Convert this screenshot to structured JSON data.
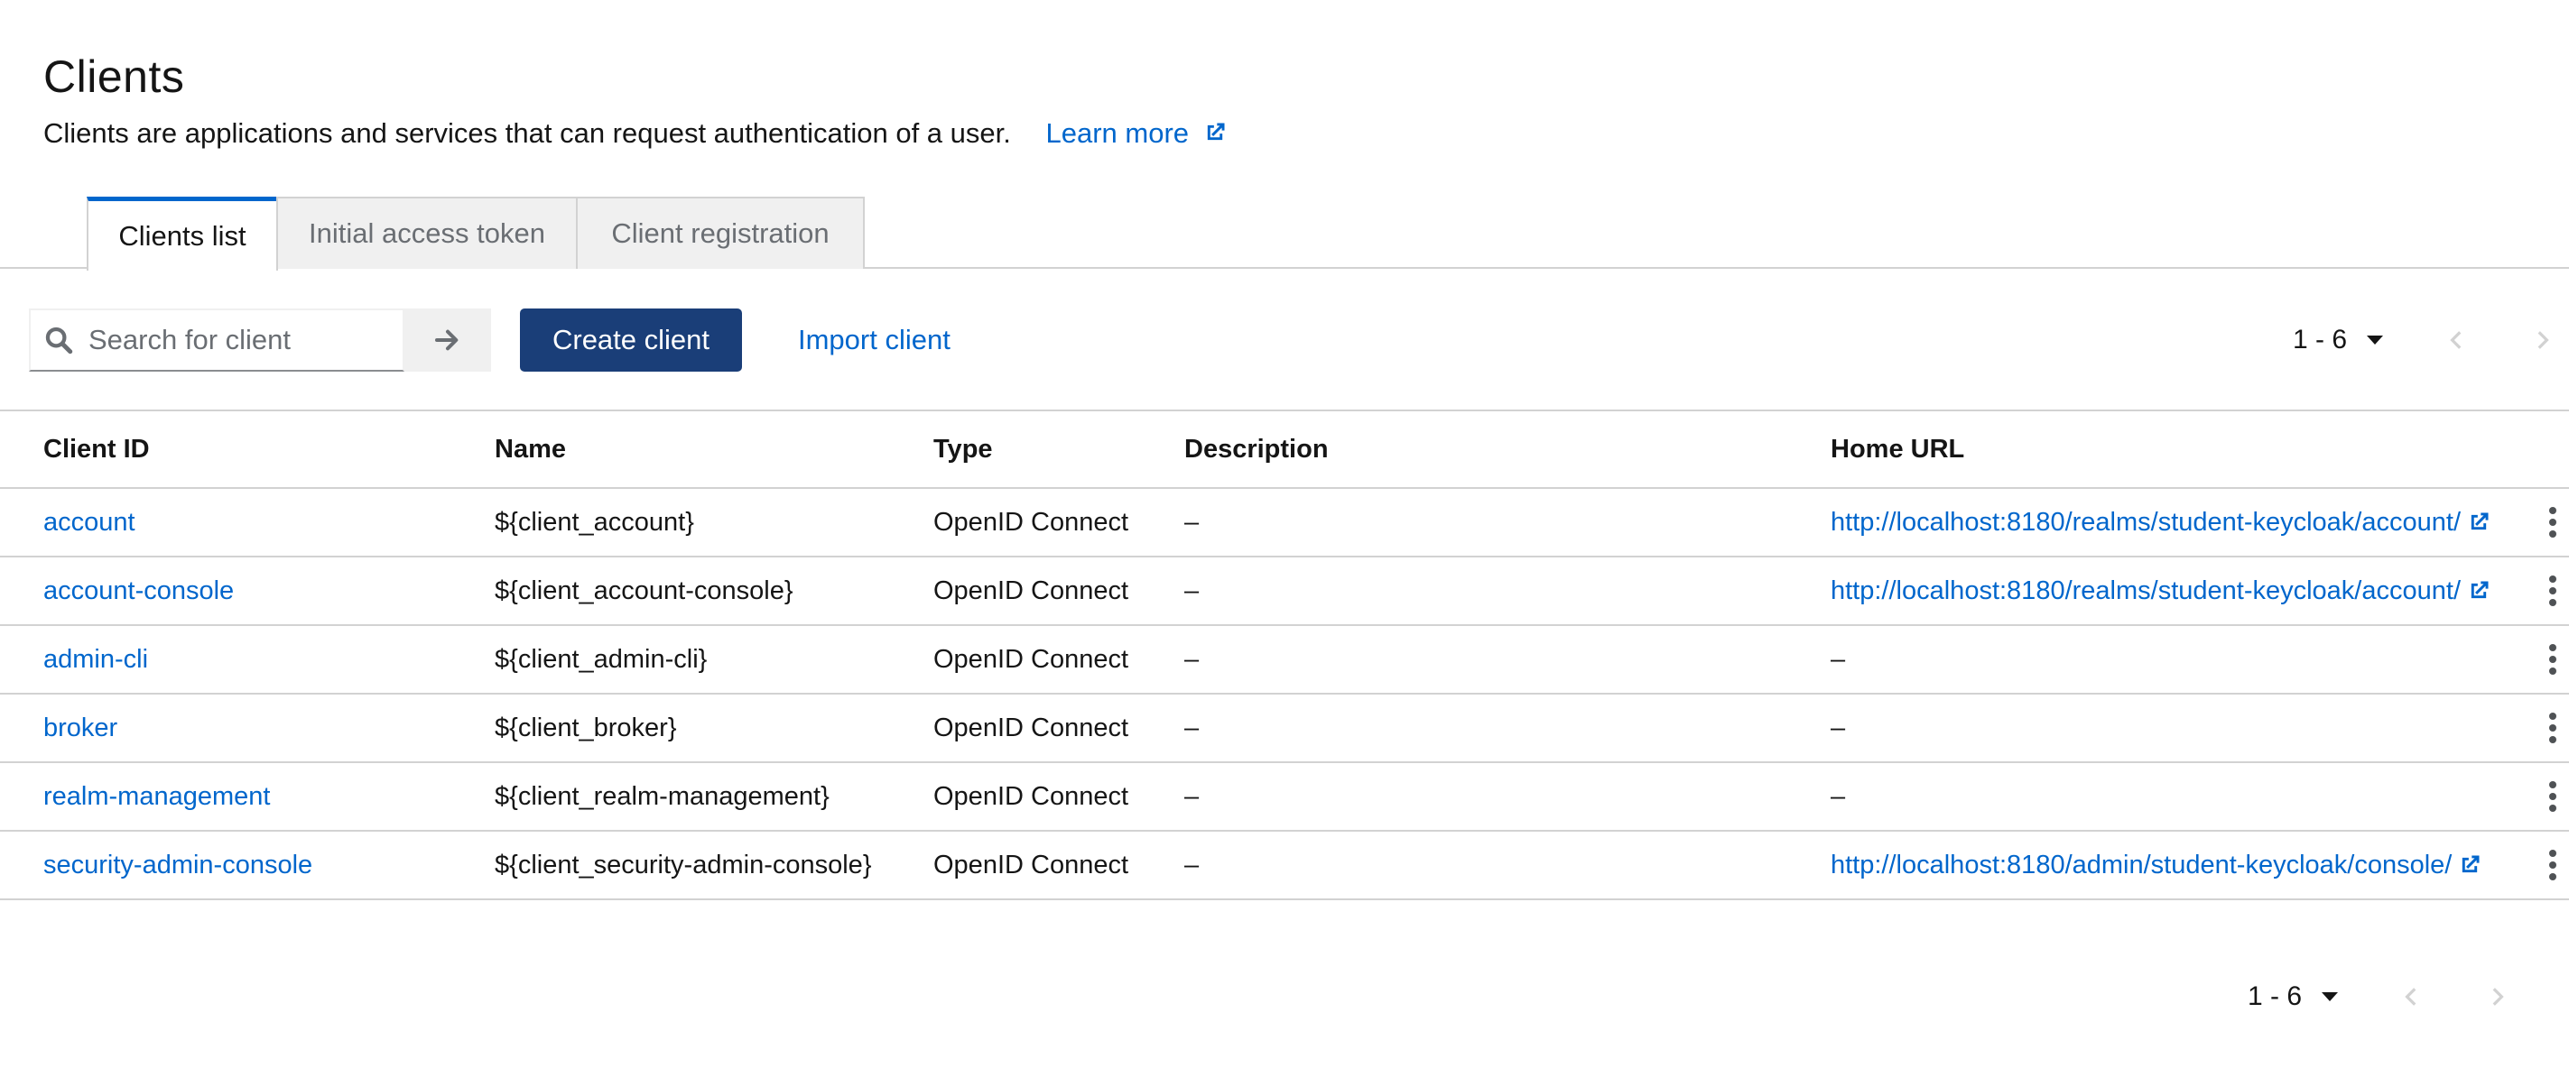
{
  "header": {
    "title": "Clients",
    "description": "Clients are applications and services that can request authentication of a user.",
    "learn_more": "Learn more"
  },
  "tabs": [
    {
      "label": "Clients list",
      "active": true
    },
    {
      "label": "Initial access token",
      "active": false
    },
    {
      "label": "Client registration",
      "active": false
    }
  ],
  "toolbar": {
    "search_placeholder": "Search for client",
    "search_value": "",
    "create_label": "Create client",
    "import_label": "Import client"
  },
  "pagination": {
    "range": "1 - 6"
  },
  "table": {
    "columns": [
      "Client ID",
      "Name",
      "Type",
      "Description",
      "Home URL"
    ],
    "rows": [
      {
        "client_id": "account",
        "name": "${client_account}",
        "type": "OpenID Connect",
        "description": "–",
        "home_url": "http://localhost:8180/realms/student-keycloak/account/",
        "url_is_link": true
      },
      {
        "client_id": "account-console",
        "name": "${client_account-console}",
        "type": "OpenID Connect",
        "description": "–",
        "home_url": "http://localhost:8180/realms/student-keycloak/account/",
        "url_is_link": true
      },
      {
        "client_id": "admin-cli",
        "name": "${client_admin-cli}",
        "type": "OpenID Connect",
        "description": "–",
        "home_url": "–",
        "url_is_link": false
      },
      {
        "client_id": "broker",
        "name": "${client_broker}",
        "type": "OpenID Connect",
        "description": "–",
        "home_url": "–",
        "url_is_link": false
      },
      {
        "client_id": "realm-management",
        "name": "${client_realm-management}",
        "type": "OpenID Connect",
        "description": "–",
        "home_url": "–",
        "url_is_link": false
      },
      {
        "client_id": "security-admin-console",
        "name": "${client_security-admin-console}",
        "type": "OpenID Connect",
        "description": "–",
        "home_url": "http://localhost:8180/admin/student-keycloak/console/",
        "url_is_link": true
      }
    ]
  },
  "colors": {
    "accent": "#0066cc",
    "primary_button": "#1a3e78",
    "border": "#d2d2d2"
  }
}
